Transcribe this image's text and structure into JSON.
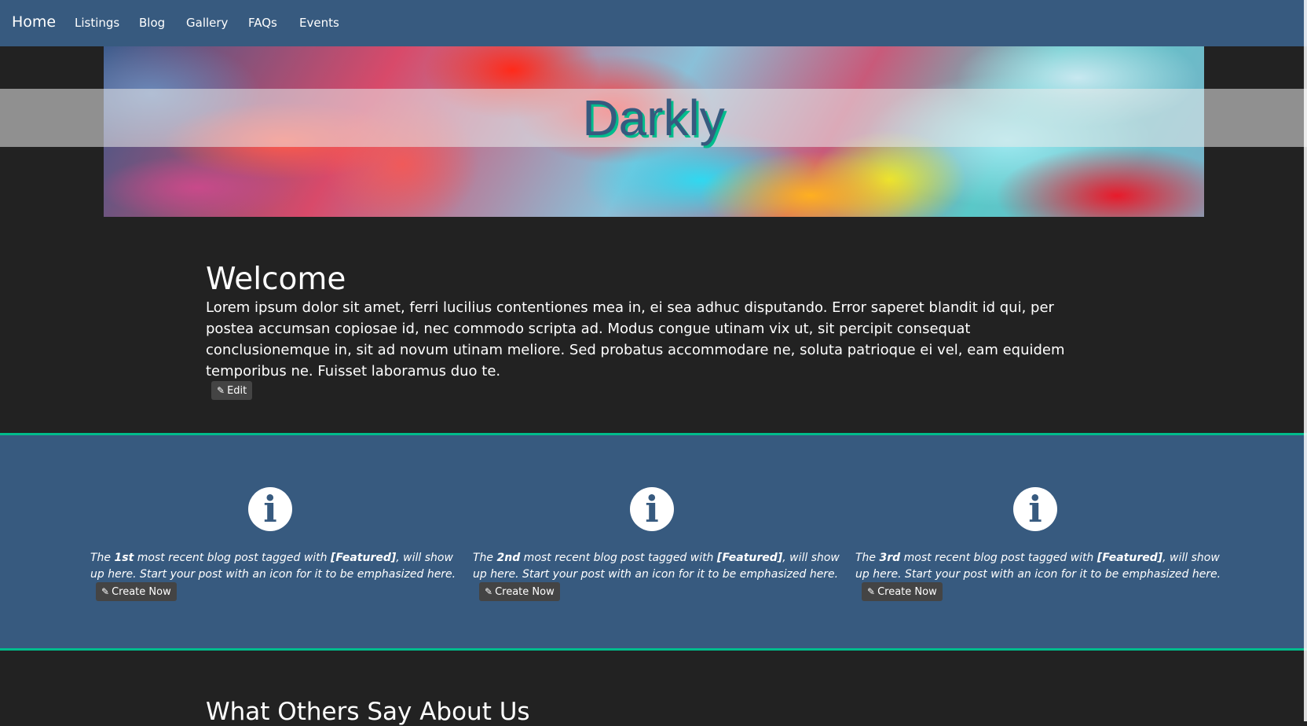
{
  "nav": {
    "brand": "Home",
    "links": [
      "Listings",
      "Blog",
      "Gallery",
      "FAQs",
      "Events"
    ]
  },
  "banner": {
    "title": "Darkly"
  },
  "welcome": {
    "title": "Welcome",
    "text": "Lorem ipsum dolor sit amet, ferri lucilius contentiones mea in, ei sea adhuc disputando. Error saperet blandit id qui, per postea accumsan copiosae id, nec commodo scripta ad. Modus congue utinam vix ut, sit percipit consequat conclusionemque in, sit ad novum utinam meliore. Sed probatus accommodare ne, soluta patrioque ei vel, eam equidem temporibus ne. Fuisset laboramus duo te.",
    "edit_label": "Edit"
  },
  "features": [
    {
      "icon": "info-icon",
      "prefix": "The ",
      "ordinal": "1st",
      "middle": " most recent blog post tagged with ",
      "tag": "[Featured]",
      "suffix": ", will show up here. Start your post with an icon for it to be emphasized here.",
      "button": "Create Now"
    },
    {
      "icon": "info-icon",
      "prefix": "The ",
      "ordinal": "2nd",
      "middle": " most recent blog post tagged with ",
      "tag": "[Featured]",
      "suffix": ", will show up here. Start your post with an icon for it to be emphasized here.",
      "button": "Create Now"
    },
    {
      "icon": "info-icon",
      "prefix": "The ",
      "ordinal": "3rd",
      "middle": " most recent blog post tagged with ",
      "tag": "[Featured]",
      "suffix": ", will show up here. Start your post with an icon for it to be emphasized here.",
      "button": "Create Now"
    }
  ],
  "testimonials": {
    "title": "What Others Say About Us"
  },
  "colors": {
    "primary": "#375a7f",
    "accent": "#00bc8c",
    "background": "#222222",
    "button": "#444444"
  }
}
